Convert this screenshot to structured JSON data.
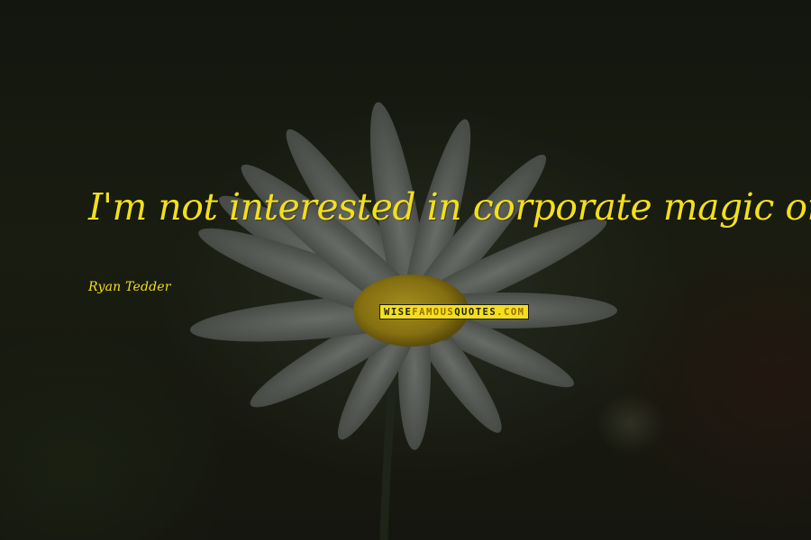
{
  "quote": {
    "text": "I'm not interested in corporate magic or fame.",
    "author": "Ryan Tedder"
  },
  "watermark": {
    "part1": "WISE",
    "part2": "FAMOUS",
    "part3": "QUOTES",
    "part4": ".COM"
  },
  "colors": {
    "quote_text": "#f3df1b",
    "background": "#1b1f14",
    "petals": "#8e938e",
    "flower_center": "#c7a91e",
    "watermark_bg": "#f3df1b"
  }
}
